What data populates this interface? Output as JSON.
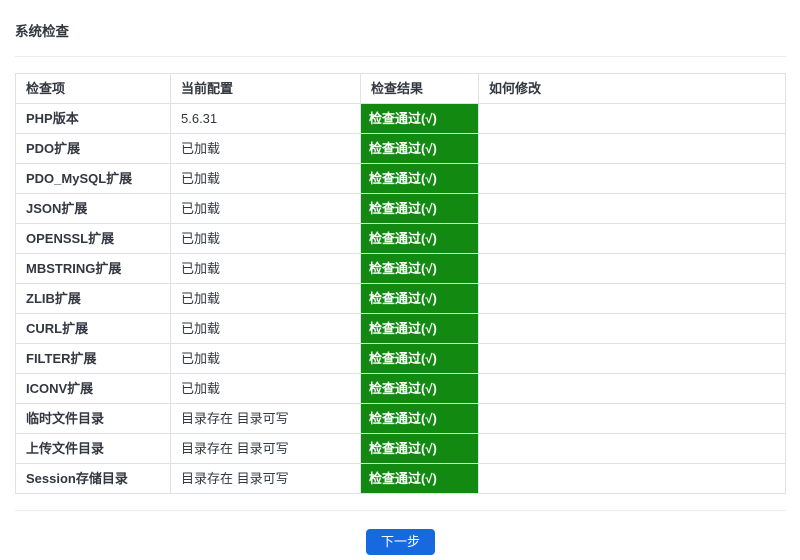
{
  "title": "系统检查",
  "colors": {
    "pass_bg": "#128a12",
    "pass_text": "#ffffff",
    "button_bg": "#1769e0",
    "button_text": "#ffffff"
  },
  "table": {
    "headers": [
      "检查项",
      "当前配置",
      "检查结果",
      "如何修改"
    ],
    "rows": [
      {
        "item": "PHP版本",
        "config": "5.6.31",
        "result": "检查通过(√)",
        "fix": ""
      },
      {
        "item": "PDO扩展",
        "config": "已加载",
        "result": "检查通过(√)",
        "fix": ""
      },
      {
        "item": "PDO_MySQL扩展",
        "config": "已加载",
        "result": "检查通过(√)",
        "fix": ""
      },
      {
        "item": "JSON扩展",
        "config": "已加载",
        "result": "检查通过(√)",
        "fix": ""
      },
      {
        "item": "OPENSSL扩展",
        "config": "已加载",
        "result": "检查通过(√)",
        "fix": ""
      },
      {
        "item": "MBSTRING扩展",
        "config": "已加载",
        "result": "检查通过(√)",
        "fix": ""
      },
      {
        "item": "ZLIB扩展",
        "config": "已加载",
        "result": "检查通过(√)",
        "fix": ""
      },
      {
        "item": "CURL扩展",
        "config": "已加载",
        "result": "检查通过(√)",
        "fix": ""
      },
      {
        "item": "FILTER扩展",
        "config": "已加载",
        "result": "检查通过(√)",
        "fix": ""
      },
      {
        "item": "ICONV扩展",
        "config": "已加载",
        "result": "检查通过(√)",
        "fix": ""
      },
      {
        "item": "临时文件目录",
        "config": "目录存在 目录可写",
        "result": "检查通过(√)",
        "fix": ""
      },
      {
        "item": "上传文件目录",
        "config": "目录存在 目录可写",
        "result": "检查通过(√)",
        "fix": ""
      },
      {
        "item": "Session存储目录",
        "config": "目录存在 目录可写",
        "result": "检查通过(√)",
        "fix": ""
      }
    ]
  },
  "footer": {
    "next_button": "下一步"
  }
}
